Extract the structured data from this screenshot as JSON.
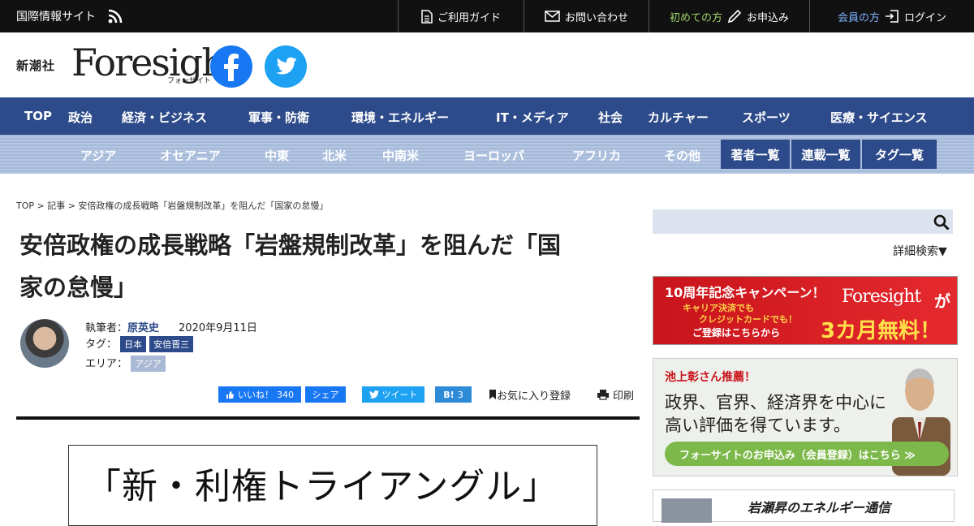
{
  "topbar": {
    "site_name": "国際情報サイト",
    "guide": "ご利用ガイド",
    "contact": "お問い合わせ",
    "first_prefix": "初めての方",
    "apply": "お申込み",
    "member_prefix": "会員の方",
    "login": "ログイン"
  },
  "header": {
    "publisher": "新潮社",
    "logo": "Foresight",
    "logo_kana": "フォーサイト"
  },
  "nav_main": [
    "TOP",
    "政治",
    "経済・ビジネス",
    "軍事・防衛",
    "環境・エネルギー",
    "IT・メディア",
    "社会",
    "カルチャー",
    "スポーツ",
    "医療・サイエンス"
  ],
  "nav_region": [
    "アジア",
    "オセアニア",
    "中東",
    "北米",
    "中南米",
    "ヨーロッパ",
    "アフリカ",
    "その他"
  ],
  "nav_buttons": [
    "著者一覧",
    "連載一覧",
    "タグ一覧"
  ],
  "article": {
    "breadcrumb": "TOP > 記事 > 安倍政権の成長戦略「岩盤規制改革」を阻んだ「国家の怠慢」",
    "title_line1": "安倍政権の成長戦略「岩盤規制改革」を阻んだ「国",
    "title_line2": "家の怠慢」",
    "author_label": "執筆者：",
    "author": "原英史",
    "date": "2020年9月11日",
    "tag_label": "タグ：",
    "tags": [
      "日本",
      "安倍晋三"
    ],
    "area_label": "エリア：",
    "areas": [
      "アジア"
    ],
    "hero_text": "「新・利権トライアングル」"
  },
  "share": {
    "like_label": "いいね！",
    "like_count": "340",
    "share_label": "シェア",
    "tweet_label": "ツイート",
    "hatena_label": "B!",
    "hatena_count": "3",
    "favorite_label": "お気に入り登録",
    "print_label": "印刷"
  },
  "sidebar": {
    "search_placeholder": "",
    "advanced_search": "詳細検索▼",
    "campaign": {
      "title": "10周年記念キャンペーン！",
      "line1": "キャリア決済でも",
      "line2": "クレジットカードでも！",
      "line3": "ご登録はこちらから",
      "brand": "Foresight",
      "brand_suffix": "が",
      "offer": "3カ月無料！"
    },
    "recommend": {
      "tag": "池上彰さん推薦！",
      "line1": "政界、官界、経済界を中心に",
      "line2": "高い評価を得ています。",
      "cta": "フォーサイトのお申込み（会員登録）はこちら ≫"
    },
    "series": {
      "title": "岩瀬昇のエネルギー通信"
    }
  },
  "colors": {
    "nav_blue": "#2d4a8a",
    "campaign_red": "#c8141b",
    "facebook": "#1877f2",
    "twitter": "#1da1f2",
    "cta_green": "#7db84a"
  }
}
